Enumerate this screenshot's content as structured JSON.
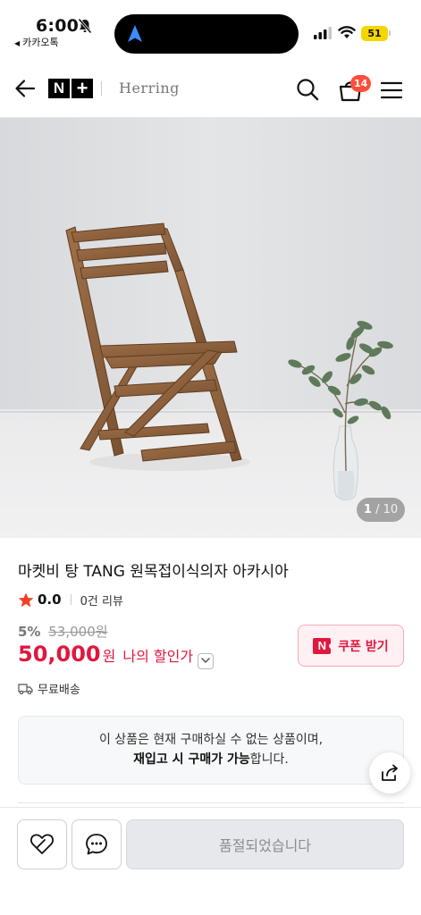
{
  "status_bar": {
    "time": "6:00",
    "back_app": "카카오톡",
    "battery": "51"
  },
  "header": {
    "brand_logo": "N+",
    "brand_name": "Herring",
    "cart_count": "14",
    "icons": [
      "back-arrow-icon",
      "search-icon",
      "cart-icon",
      "menu-icon"
    ]
  },
  "gallery": {
    "current": "1",
    "total": "/ 10"
  },
  "product": {
    "title": "마켓비 탕 TANG 원목접이식의자 아카시아",
    "rating": "0.0",
    "review_count": "0건 리뷰",
    "discount_rate": "5%",
    "original_price": "53,000원",
    "price": "50,000",
    "price_unit": "원",
    "my_discount_label": "나의 할인가",
    "coupon_label": "쿠폰 받기",
    "shipping": "무료배송"
  },
  "notice": {
    "line1": "이 상품은 현재 구매하실 수 없는 상품이며,",
    "line2_bold": "재입고 시 구매가 가능",
    "line2_rest": "합니다."
  },
  "bottom_bar": {
    "soldout_label": "품절되었습니다"
  },
  "colors": {
    "accent_red": "#e0173f",
    "badge_red": "#ff4d3a",
    "battery_yellow": "#f5d600"
  }
}
